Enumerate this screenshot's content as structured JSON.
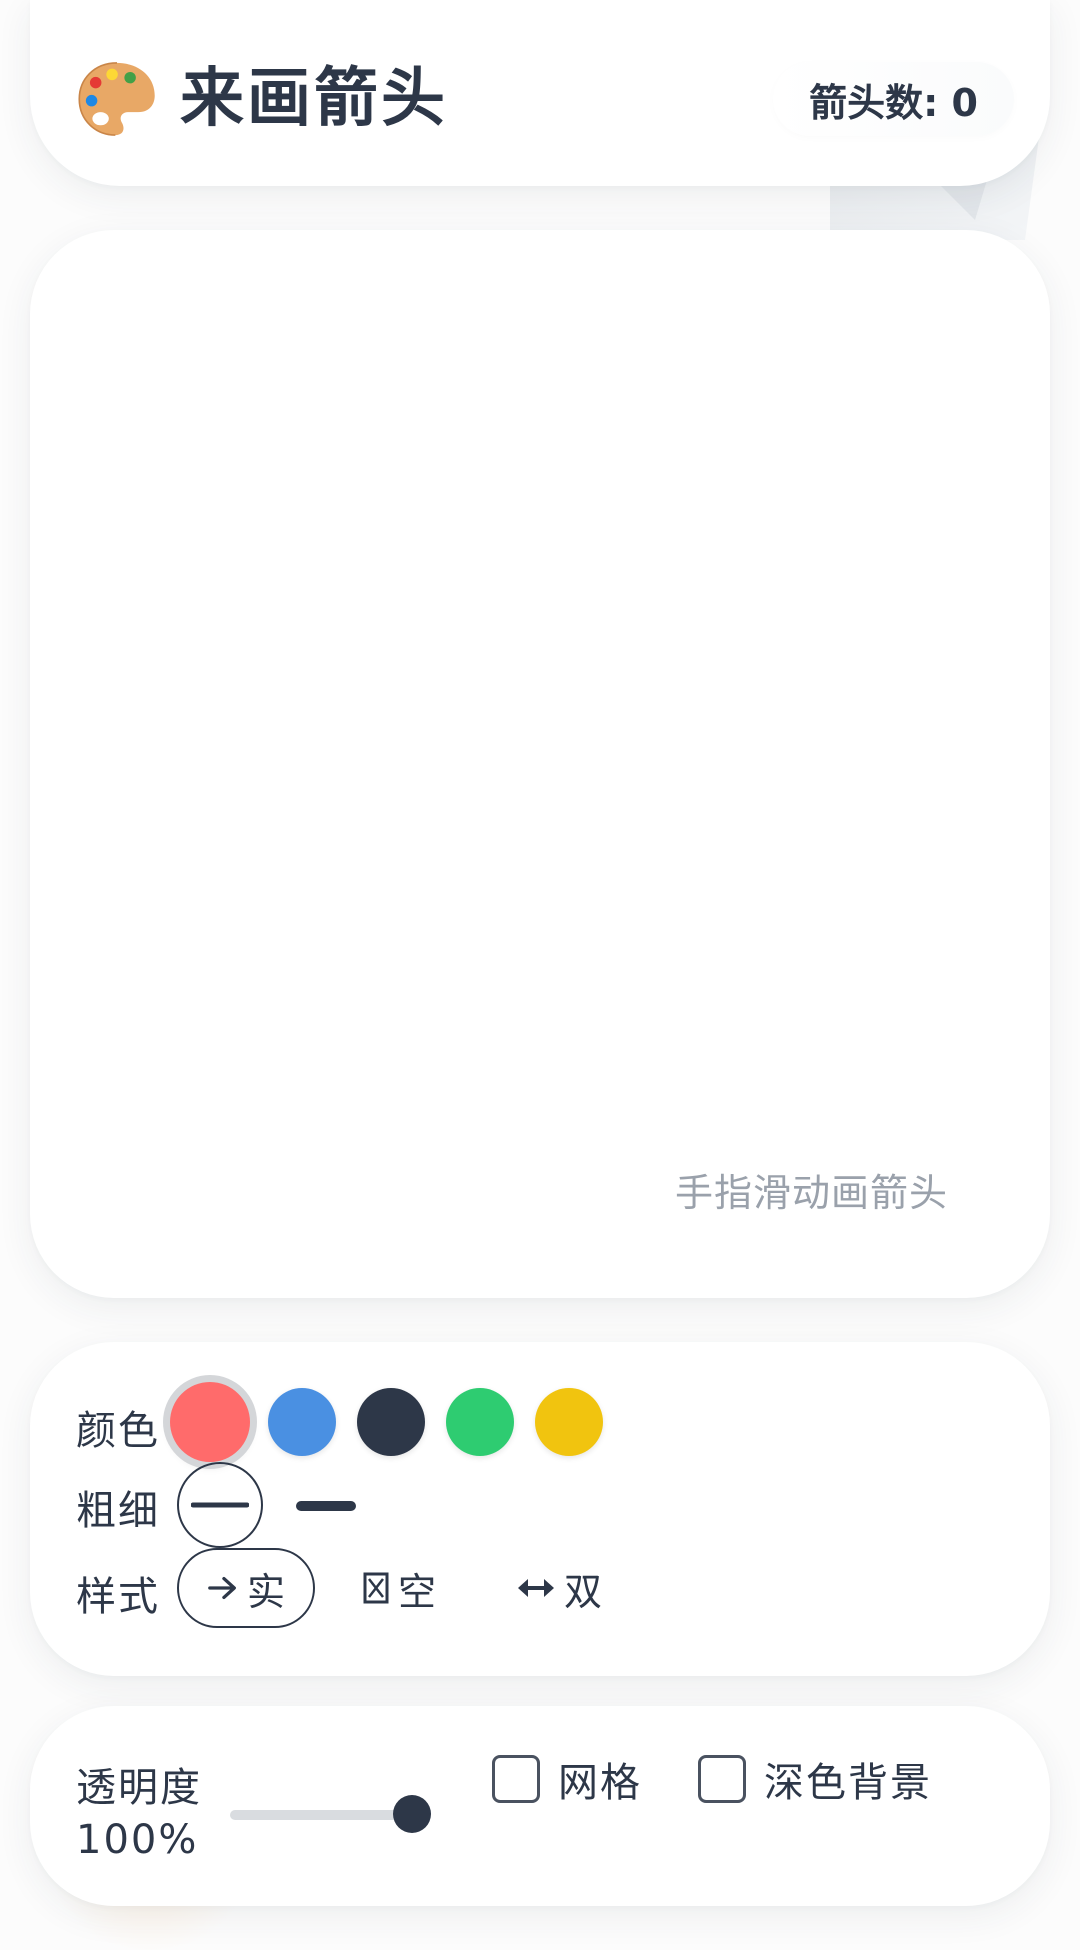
{
  "header": {
    "title": "来画箭头",
    "arrow_count_label": "箭头数: 0"
  },
  "canvas": {
    "hint": "手指滑动画箭头"
  },
  "toolbar": {
    "color_label": "颜色",
    "colors": [
      "#ff6b6b",
      "#4a90e2",
      "#2d3748",
      "#2ecc71",
      "#f1c40f"
    ],
    "selected_color": "#ff6b6b",
    "width_label": "粗细",
    "widths": [
      "thin",
      "thick"
    ],
    "selected_width": "thin",
    "style_label": "样式",
    "styles": [
      {
        "icon": "arrow-right-icon",
        "label": "实"
      },
      {
        "icon": "hollow-box-icon",
        "label": "空"
      },
      {
        "icon": "double-arrow-icon",
        "label": "双"
      }
    ],
    "selected_style": "实"
  },
  "settings": {
    "opacity_label": "透明度",
    "opacity_value": "100%",
    "opacity_level": 1.0,
    "grid_label": "网格",
    "grid_checked": false,
    "dark_label": "深色背景",
    "dark_checked": false
  }
}
